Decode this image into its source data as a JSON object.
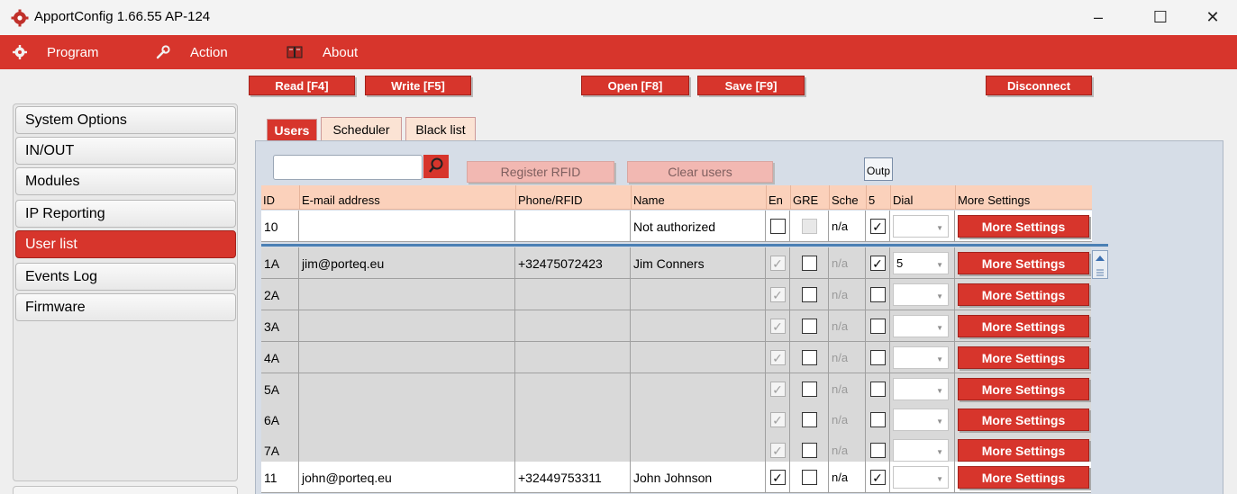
{
  "window": {
    "title": "ApportConfig 1.66.55   AP-124",
    "minimize": "–",
    "maximize": "☐",
    "close": "✕"
  },
  "menu": {
    "items": [
      {
        "label": "Program",
        "icon": "gear-icon"
      },
      {
        "label": "Action",
        "icon": "wrench-icon"
      },
      {
        "label": "About",
        "icon": "book-icon"
      }
    ]
  },
  "toolbar": {
    "read": "Read [F4]",
    "write": "Write [F5]",
    "open": "Open [F8]",
    "save": "Save [F9]",
    "disconnect": "Disconnect"
  },
  "sidebar": {
    "items": [
      {
        "label": "System Options",
        "active": false
      },
      {
        "label": "IN/OUT",
        "active": false
      },
      {
        "label": "Modules",
        "active": false
      },
      {
        "label": "IP Reporting",
        "active": false
      },
      {
        "label": "User list",
        "active": true
      },
      {
        "label": "Events Log",
        "active": false
      },
      {
        "label": "Firmware",
        "active": false
      }
    ]
  },
  "tabs": [
    {
      "label": "Users",
      "active": true
    },
    {
      "label": "Scheduler",
      "active": false
    },
    {
      "label": "Black list",
      "active": false
    }
  ],
  "actions": {
    "search_value": "",
    "register_rfid": "Register RFID",
    "clear_users": "Clear users",
    "outputs_header": "Outp"
  },
  "table": {
    "columns": [
      "ID",
      "E-mail address",
      "Phone/RFID",
      "Name",
      "En",
      "GRE",
      "Sche",
      "5",
      "Dial",
      "More Settings"
    ],
    "more_label": "More Settings",
    "rows": [
      {
        "id": "10",
        "email": "",
        "phone": "",
        "name": "Not authorized",
        "en": false,
        "en_disabled": false,
        "gre": false,
        "gre_gray": true,
        "sched": "n/a",
        "out5": true,
        "dial": ""
      },
      {
        "id": "1A",
        "email": "jim@porteq.eu",
        "phone": "+32475072423",
        "name": "Jim Conners",
        "en": true,
        "en_disabled": true,
        "gre": false,
        "gre_gray": false,
        "sched": "n/a",
        "out5": true,
        "dial": "5"
      },
      {
        "id": "2A",
        "email": "",
        "phone": "",
        "name": "",
        "en": true,
        "en_disabled": true,
        "gre": false,
        "gre_gray": false,
        "sched": "n/a",
        "out5": false,
        "dial": ""
      },
      {
        "id": "3A",
        "email": "",
        "phone": "",
        "name": "",
        "en": true,
        "en_disabled": true,
        "gre": false,
        "gre_gray": false,
        "sched": "n/a",
        "out5": false,
        "dial": ""
      },
      {
        "id": "4A",
        "email": "",
        "phone": "",
        "name": "",
        "en": true,
        "en_disabled": true,
        "gre": false,
        "gre_gray": false,
        "sched": "n/a",
        "out5": false,
        "dial": ""
      },
      {
        "id": "5A",
        "email": "",
        "phone": "",
        "name": "",
        "en": true,
        "en_disabled": true,
        "gre": false,
        "gre_gray": false,
        "sched": "n/a",
        "out5": false,
        "dial": ""
      },
      {
        "id": "6A",
        "email": "",
        "phone": "",
        "name": "",
        "en": true,
        "en_disabled": true,
        "gre": false,
        "gre_gray": false,
        "sched": "n/a",
        "out5": false,
        "dial": ""
      },
      {
        "id": "7A",
        "email": "",
        "phone": "",
        "name": "",
        "en": true,
        "en_disabled": true,
        "gre": false,
        "gre_gray": false,
        "sched": "n/a",
        "out5": false,
        "dial": ""
      },
      {
        "id": "11",
        "email": "john@porteq.eu",
        "phone": "+32449753311",
        "name": "John Johnson",
        "en": true,
        "en_disabled": false,
        "gre": false,
        "gre_gray": false,
        "sched": "n/a",
        "out5": true,
        "dial": ""
      }
    ]
  },
  "colors": {
    "accent": "#d7352c",
    "header_bg": "#fbd1bb",
    "panel_bg": "#d6dde7",
    "row_gray": "#d9d9d9"
  }
}
